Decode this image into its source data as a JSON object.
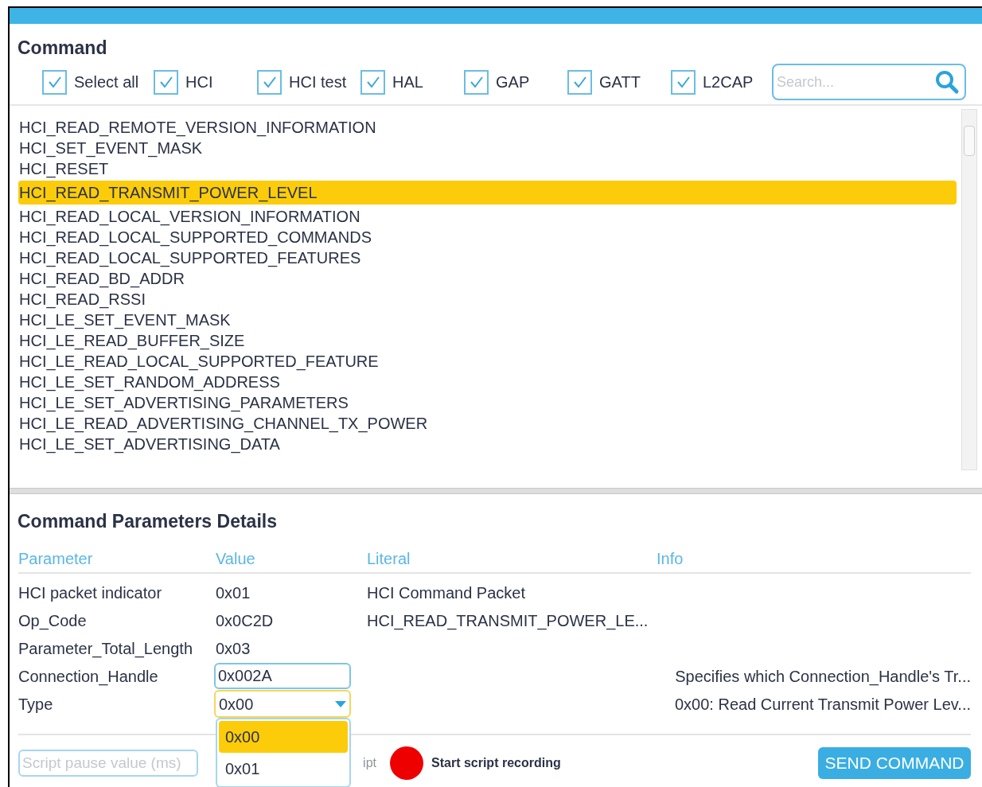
{
  "command": {
    "title": "Command",
    "filters": [
      {
        "label": "Select all",
        "checked": true
      },
      {
        "label": "HCI",
        "checked": true
      },
      {
        "label": "HCI test",
        "checked": true
      },
      {
        "label": "HAL",
        "checked": true
      },
      {
        "label": "GAP",
        "checked": true
      },
      {
        "label": "GATT",
        "checked": true
      },
      {
        "label": "L2CAP",
        "checked": true
      }
    ],
    "search": {
      "placeholder": "Search..."
    },
    "items": [
      {
        "label": "HCI_READ_REMOTE_VERSION_INFORMATION",
        "selected": false
      },
      {
        "label": "HCI_SET_EVENT_MASK",
        "selected": false
      },
      {
        "label": "HCI_RESET",
        "selected": false
      },
      {
        "label": "HCI_READ_TRANSMIT_POWER_LEVEL",
        "selected": true
      },
      {
        "label": "HCI_READ_LOCAL_VERSION_INFORMATION",
        "selected": false
      },
      {
        "label": "HCI_READ_LOCAL_SUPPORTED_COMMANDS",
        "selected": false
      },
      {
        "label": "HCI_READ_LOCAL_SUPPORTED_FEATURES",
        "selected": false
      },
      {
        "label": "HCI_READ_BD_ADDR",
        "selected": false
      },
      {
        "label": "HCI_READ_RSSI",
        "selected": false
      },
      {
        "label": "HCI_LE_SET_EVENT_MASK",
        "selected": false
      },
      {
        "label": "HCI_LE_READ_BUFFER_SIZE",
        "selected": false
      },
      {
        "label": "HCI_LE_READ_LOCAL_SUPPORTED_FEATURE",
        "selected": false
      },
      {
        "label": "HCI_LE_SET_RANDOM_ADDRESS",
        "selected": false
      },
      {
        "label": "HCI_LE_SET_ADVERTISING_PARAMETERS",
        "selected": false
      },
      {
        "label": "HCI_LE_READ_ADVERTISING_CHANNEL_TX_POWER",
        "selected": false
      },
      {
        "label": "HCI_LE_SET_ADVERTISING_DATA",
        "selected": false
      }
    ]
  },
  "parameters": {
    "title": "Command Parameters Details",
    "columns": [
      "Parameter",
      "Value",
      "Literal",
      "Info"
    ],
    "rows": [
      {
        "parameter": "HCI packet indicator",
        "kind": "text",
        "value": "0x01",
        "literal": "HCI Command Packet"
      },
      {
        "parameter": "Op_Code",
        "kind": "text",
        "value": "0x0C2D",
        "literal": "HCI_READ_TRANSMIT_POWER_LE..."
      },
      {
        "parameter": "Parameter_Total_Length",
        "kind": "text",
        "value": "0x03"
      },
      {
        "parameter": "Connection_Handle",
        "kind": "input",
        "value": "0x002A",
        "info": "Specifies which Connection_Handle's Tr..."
      },
      {
        "parameter": "Type",
        "kind": "select",
        "value": "0x00",
        "info": "0x00: Read Current Transmit Power Lev...",
        "options": [
          {
            "label": "0x00",
            "selected": true
          },
          {
            "label": "0x01",
            "selected": false
          }
        ]
      }
    ]
  },
  "footer": {
    "pause": {
      "placeholder": "Script pause value (ms)"
    },
    "hidden_button_text": "ipt",
    "record": "Start script recording",
    "send": "SEND COMMAND"
  }
}
